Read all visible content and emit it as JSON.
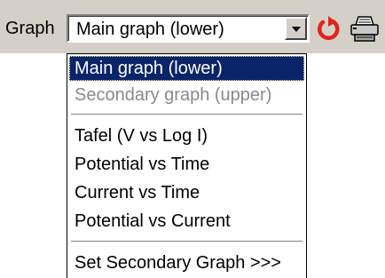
{
  "toolbar": {
    "graph_label": "Graph",
    "selected_value": "Main graph (lower)",
    "refresh_icon": "refresh-icon",
    "print_icon": "printer-icon"
  },
  "dropdown": {
    "items": [
      {
        "label": "Main graph (lower)",
        "state": "selected"
      },
      {
        "label": "Secondary graph (upper)",
        "state": "disabled"
      },
      {
        "label": "Tafel (V vs Log I)",
        "state": "normal"
      },
      {
        "label": "Potential vs Time",
        "state": "normal"
      },
      {
        "label": "Current vs Time",
        "state": "normal"
      },
      {
        "label": "Potential vs Current",
        "state": "normal"
      },
      {
        "label": "Set Secondary Graph >>>",
        "state": "normal"
      }
    ]
  },
  "colors": {
    "toolbar_bg": "#d4d0c8",
    "selection_bg": "#0a246a",
    "selection_text": "#ffffff",
    "disabled_text": "#8a8a8a",
    "refresh_icon": "#e0241a"
  }
}
